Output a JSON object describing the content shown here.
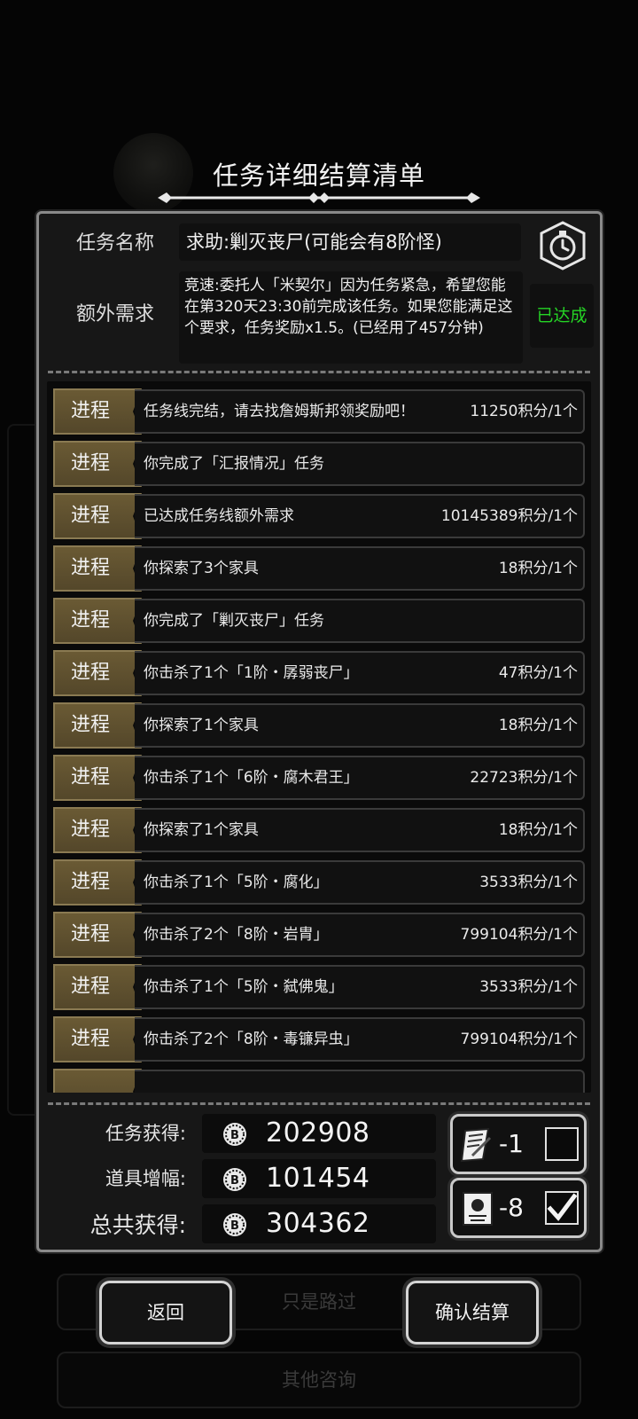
{
  "background": {
    "buttons": [
      "只是路过",
      "其他咨询"
    ]
  },
  "dialog": {
    "title": "任务详细结算清单",
    "task_name_label": "任务名称",
    "task_name": "求助:剿灭丧尸(可能会有8阶怪)",
    "extra_req_label": "额外需求",
    "extra_req": "竞速:委托人「米契尔」因为任务紧急，希望您能在第320天23:30前完成该任务。如果您能满足这个要求，任务奖励x1.5。(已经用了457分钟)",
    "extra_status": "已达成"
  },
  "progress": {
    "tag": "进程",
    "rows": [
      {
        "desc": "任务线完结，请去找詹姆斯邦领奖励吧！",
        "points": "11250积分/1个"
      },
      {
        "desc": "你完成了「汇报情况」任务",
        "points": ""
      },
      {
        "desc": "已达成任务线额外需求",
        "points": "10145389积分/1个"
      },
      {
        "desc": "你探索了3个家具",
        "points": "18积分/1个"
      },
      {
        "desc": "你完成了「剿灭丧尸」任务",
        "points": ""
      },
      {
        "desc": "你击杀了1个「1阶・孱弱丧尸」",
        "points": "47积分/1个"
      },
      {
        "desc": "你探索了1个家具",
        "points": "18积分/1个"
      },
      {
        "desc": "你击杀了1个「6阶・腐木君王」",
        "points": "22723积分/1个"
      },
      {
        "desc": "你探索了1个家具",
        "points": "18积分/1个"
      },
      {
        "desc": "你击杀了1个「5阶・腐化」",
        "points": "3533积分/1个"
      },
      {
        "desc": "你击杀了2个「8阶・岩胄」",
        "points": "799104积分/1个"
      },
      {
        "desc": "你击杀了1个「5阶・弑佛鬼」",
        "points": "3533积分/1个"
      },
      {
        "desc": "你击杀了2个「8阶・毒镰异虫」",
        "points": "799104积分/1个"
      }
    ]
  },
  "totals": {
    "mission_label": "任务获得:",
    "mission_value": "202908",
    "item_label": "道具增幅:",
    "item_value": "101454",
    "total_label": "总共获得:",
    "total_value": "304362"
  },
  "items": [
    {
      "icon": "scroll-icon",
      "count": "-1",
      "checked": false
    },
    {
      "icon": "ticket-icon",
      "count": "-8",
      "checked": true
    }
  ],
  "actions": {
    "back": "返回",
    "confirm": "确认结算"
  },
  "colors": {
    "achieved": "#25d425",
    "tag_bg": "#5c4e2e",
    "panel_border": "#8a8a8a"
  }
}
